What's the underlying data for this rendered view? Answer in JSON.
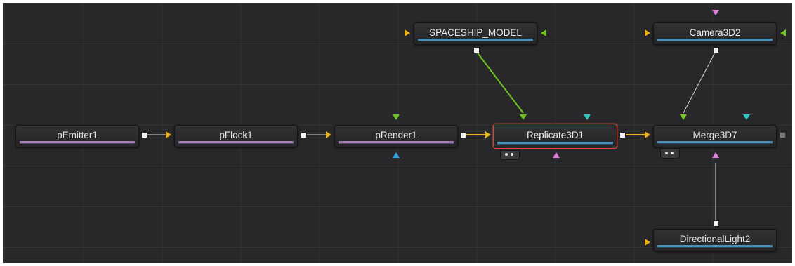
{
  "nodes": {
    "spaceship_model": "SPACESHIP_MODEL",
    "camera3d2": "Camera3D2",
    "pemitter1": "pEmitter1",
    "pflock1": "pFlock1",
    "prender1": "pRender1",
    "replicate3d1": "Replicate3D1",
    "merge3d7": "Merge3D7",
    "directionallight2": "DirectionalLight2"
  },
  "colors": {
    "canvas": "#28282a",
    "particle_bar": "#a07cb0",
    "threed_bar": "#4a8fb6",
    "selection_border": "#e04a3a",
    "input_yellow": "#e6b21e",
    "input_green": "#6fc41f",
    "input_cyan": "#2fc6c6",
    "input_pink": "#e07ee0",
    "input_blue": "#2ea6e8"
  },
  "selected_node": "Replicate3D1"
}
